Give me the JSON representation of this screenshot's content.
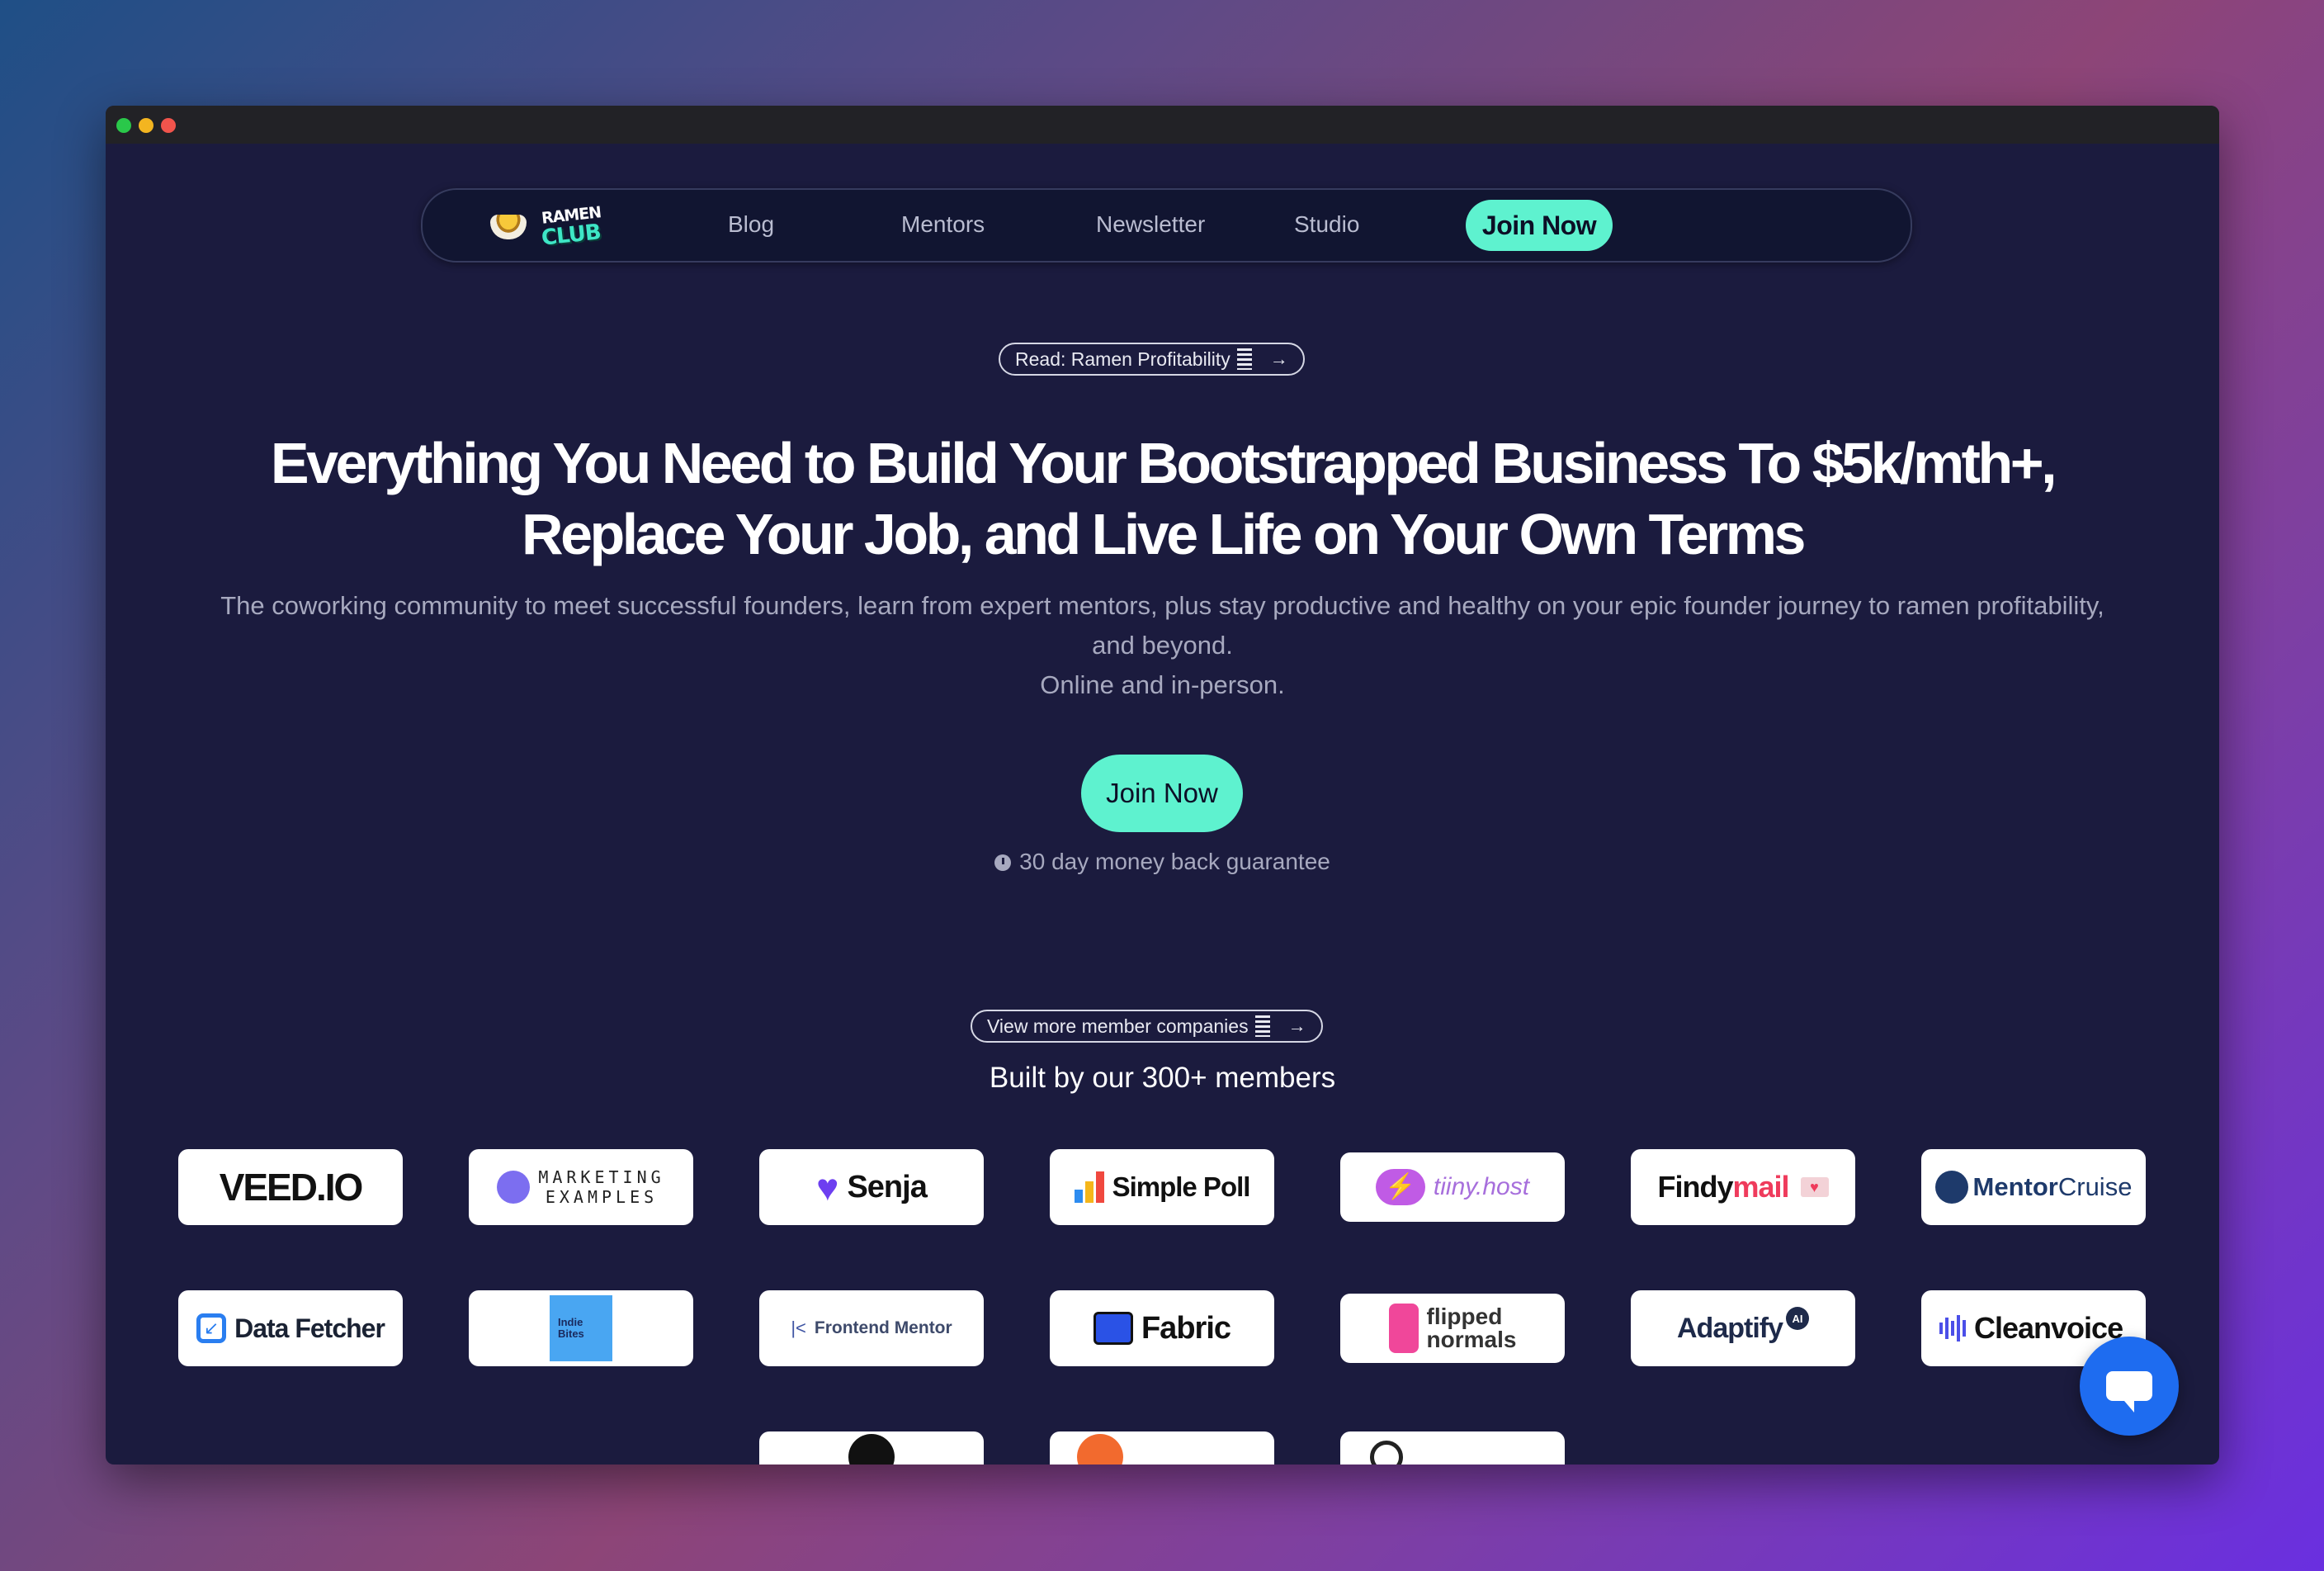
{
  "nav": {
    "logo_line1": "RAMEN",
    "logo_line2": "CLUB",
    "links": [
      "Blog",
      "Mentors",
      "Newsletter",
      "Studio"
    ],
    "join_label": "Join Now"
  },
  "hero": {
    "read_pill": "Read: Ramen Profitability",
    "headline_line1": "Everything You Need to Build Your Bootstrapped Business To $5k/mth+,",
    "headline_line2": "Replace Your Job, and Live Life on Your Own Terms",
    "sub_line1": "The coworking community to meet successful founders, learn from expert mentors, plus stay productive and healthy on your epic founder journey to ramen profitability,",
    "sub_line2": "and beyond.",
    "sub_line3": "Online and in-person.",
    "cta_label": "Join Now",
    "guarantee": "30 day money back guarantee"
  },
  "companies": {
    "view_pill": "View more member companies",
    "title": "Built by our 300+ members",
    "row1": [
      "VEED.IO",
      "MARKETING",
      "EXAMPLES",
      "Senja",
      "Simple Poll",
      "tiiny.host",
      "Findy",
      "mail",
      "Mentor",
      "Cruise"
    ],
    "row2": [
      "Data Fetcher",
      "Indie",
      "Bites",
      "Frontend Mentor",
      "Fabric",
      "flipped",
      "normals",
      "Adaptify",
      "AI",
      "Cleanvoice"
    ]
  },
  "colors": {
    "accent": "#5ef2cf",
    "page_bg": "#1b1b3e",
    "chat_button": "#1e6cf0"
  }
}
